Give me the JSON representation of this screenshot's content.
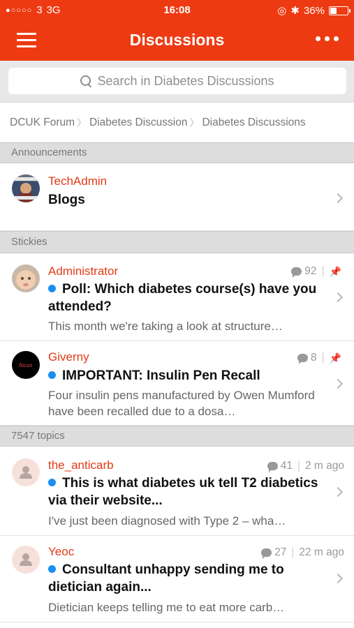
{
  "status_bar": {
    "signal_dots": "●○○○○",
    "carrier": "3",
    "network": "3G",
    "time": "16:08",
    "battery_percent": "36%",
    "battery_level": 0.36,
    "icons": [
      "lock-rotation-icon",
      "bluetooth-icon",
      "battery-icon"
    ]
  },
  "navbar": {
    "title": "Discussions",
    "menu_icon": "hamburger-menu-icon",
    "more_icon": "more-dots-icon",
    "accent_color": "#ee3a12"
  },
  "search": {
    "placeholder": "Search in Diabetes Discussions",
    "icon": "search-icon"
  },
  "breadcrumb": [
    "DCUK Forum",
    "Diabetes Discussion",
    "Diabetes Discussions"
  ],
  "sections": {
    "announcements": "Announcements",
    "stickies": "Stickies",
    "topics": "7547 topics"
  },
  "announcements": [
    {
      "author": "TechAdmin",
      "title": "Blogs"
    }
  ],
  "stickies": [
    {
      "author": "Administrator",
      "title": "Poll: Which diabetes course(s) have you attended?",
      "excerpt": "This month we're taking a look at structure…",
      "replies": "92",
      "pinned": true,
      "unread": true
    },
    {
      "author": "Giverny",
      "avatar_text": "focus",
      "title": "IMPORTANT: Insulin Pen Recall",
      "excerpt": "Four insulin pens manufactured by Owen Mumford have been recalled due to a dosa…",
      "replies": "8",
      "pinned": true,
      "unread": true
    }
  ],
  "topics": [
    {
      "author": "the_anticarb",
      "title": "This is what diabetes uk tell T2 diabetics via their website...",
      "excerpt": "I've just been diagnosed with Type 2 – wha…",
      "replies": "41",
      "time": "2 m ago",
      "unread": true
    },
    {
      "author": "Yeoc",
      "title": "Consultant unhappy sending me to dietician again...",
      "excerpt": "Dietician keeps telling me to eat more carb…",
      "replies": "27",
      "time": "22 m ago",
      "unread": true
    }
  ],
  "colors": {
    "accent": "#ee3a12",
    "author": "#e23a14",
    "unread_dot": "#1b8ff0"
  }
}
